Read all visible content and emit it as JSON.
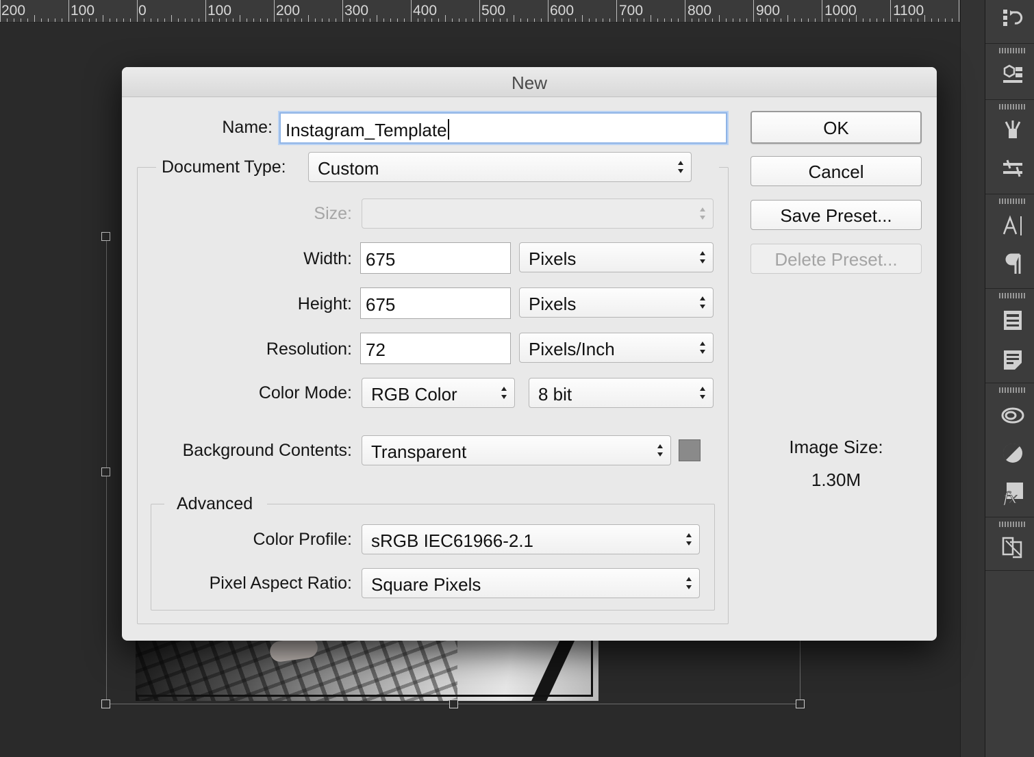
{
  "ruler": {
    "labels": [
      "200",
      "100",
      "0",
      "100",
      "200",
      "300",
      "400",
      "500",
      "600",
      "700",
      "800",
      "900",
      "1000",
      "1100"
    ]
  },
  "dialog": {
    "title": "New",
    "name_label": "Name:",
    "name_value": "Instagram_Template",
    "document_type_label": "Document Type:",
    "document_type_value": "Custom",
    "size_label": "Size:",
    "size_value": "",
    "width_label": "Width:",
    "width_value": "675",
    "width_unit": "Pixels",
    "height_label": "Height:",
    "height_value": "675",
    "height_unit": "Pixels",
    "resolution_label": "Resolution:",
    "resolution_value": "72",
    "resolution_unit": "Pixels/Inch",
    "color_mode_label": "Color Mode:",
    "color_mode_value": "RGB Color",
    "bit_depth_value": "8 bit",
    "background_label": "Background Contents:",
    "background_value": "Transparent",
    "background_swatch_color": "#8a8a8a",
    "advanced_label": "Advanced",
    "color_profile_label": "Color Profile:",
    "color_profile_value": "sRGB IEC61966-2.1",
    "pixel_aspect_label": "Pixel Aspect Ratio:",
    "pixel_aspect_value": "Square Pixels"
  },
  "buttons": {
    "ok": "OK",
    "cancel": "Cancel",
    "save_preset": "Save Preset...",
    "delete_preset": "Delete Preset..."
  },
  "image_size": {
    "label": "Image Size:",
    "value": "1.30M"
  },
  "panel_icons": [
    "history-icon",
    "3d-icon",
    "brush-icon",
    "brush-presets-icon",
    "character-icon",
    "paragraph-icon",
    "properties-icon",
    "notes-icon",
    "creative-cloud-icon",
    "adjustments-icon",
    "styles-icon",
    "clone-source-icon"
  ]
}
